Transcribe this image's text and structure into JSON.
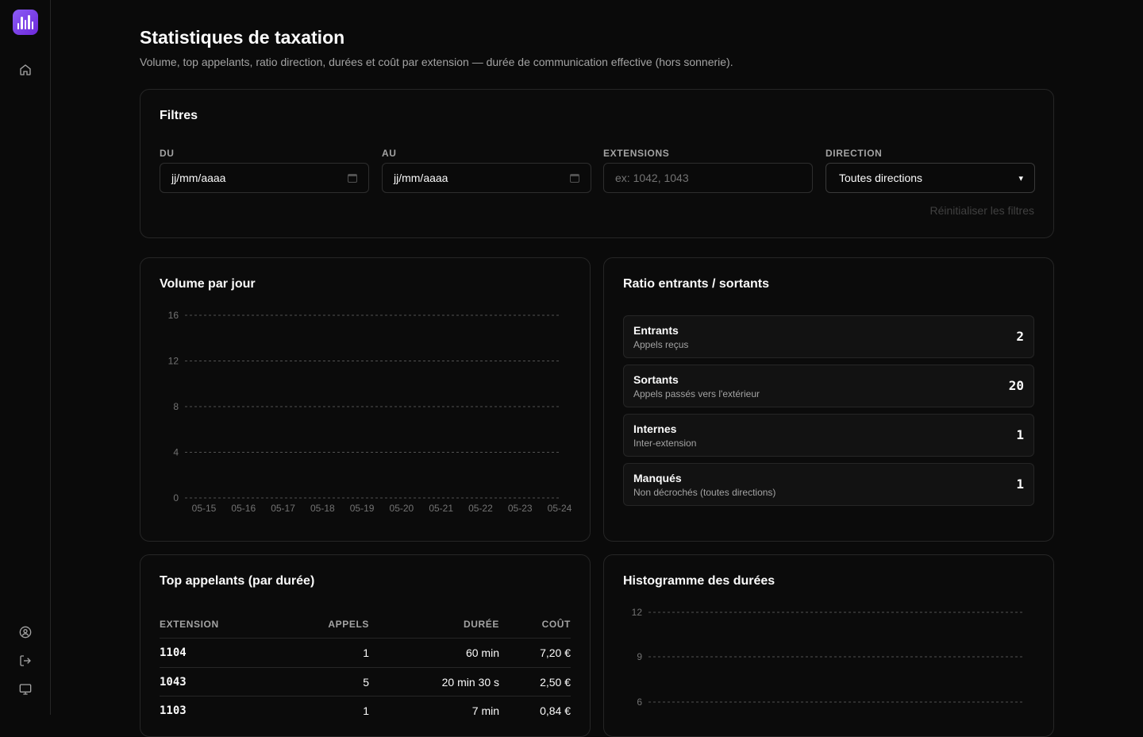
{
  "page": {
    "title": "Statistiques de taxation",
    "subtitle": "Volume, top appelants, ratio direction, durées et coût par extension — durée de communication effective (hors sonnerie)."
  },
  "sidebar": {
    "icons": [
      "logo-icon",
      "home-icon",
      "user-circle-icon",
      "logout-icon",
      "monitor-icon"
    ]
  },
  "filters": {
    "title": "Filtres",
    "du_label": "DU",
    "du_value": "jj/mm/aaaa",
    "au_label": "AU",
    "au_value": "jj/mm/aaaa",
    "extensions_label": "EXTENSIONS",
    "extensions_placeholder": "ex: 1042, 1043",
    "direction_label": "DIRECTION",
    "direction_value": "Toutes directions",
    "reset_label": "Réinitialiser les filtres"
  },
  "volume": {
    "title": "Volume par jour",
    "chart_data": {
      "type": "line",
      "categories": [
        "05-15",
        "05-16",
        "05-17",
        "05-18",
        "05-19",
        "05-20",
        "05-21",
        "05-22",
        "05-23",
        "05-24"
      ],
      "y_ticks": [
        "0",
        "4",
        "8",
        "12",
        "16"
      ],
      "ylim": [
        0,
        16
      ],
      "grid": true
    }
  },
  "ratio": {
    "title": "Ratio entrants / sortants",
    "rows": [
      {
        "name": "Entrants",
        "desc": "Appels reçus",
        "value": "2"
      },
      {
        "name": "Sortants",
        "desc": "Appels passés vers l'extérieur",
        "value": "20"
      },
      {
        "name": "Internes",
        "desc": "Inter-extension",
        "value": "1"
      },
      {
        "name": "Manqués",
        "desc": "Non décrochés (toutes directions)",
        "value": "1"
      }
    ]
  },
  "top_callers": {
    "title": "Top appelants (par durée)",
    "headers": {
      "extension": "EXTENSION",
      "appels": "APPELS",
      "duree": "DURÉE",
      "cout": "COÛT"
    },
    "rows": [
      {
        "extension": "1104",
        "appels": "1",
        "duree": "60 min",
        "cout": "7,20 €"
      },
      {
        "extension": "1043",
        "appels": "5",
        "duree": "20 min 30 s",
        "cout": "2,50 €"
      },
      {
        "extension": "1103",
        "appels": "1",
        "duree": "7 min",
        "cout": "0,84 €"
      }
    ]
  },
  "histogram": {
    "title": "Histogramme des durées",
    "chart_data": {
      "type": "bar",
      "y_ticks": [
        "6",
        "9",
        "12"
      ],
      "grid": true
    }
  },
  "colors": {
    "accent": "#8b5cf6",
    "background": "#0a0a0a",
    "border": "#262626"
  }
}
